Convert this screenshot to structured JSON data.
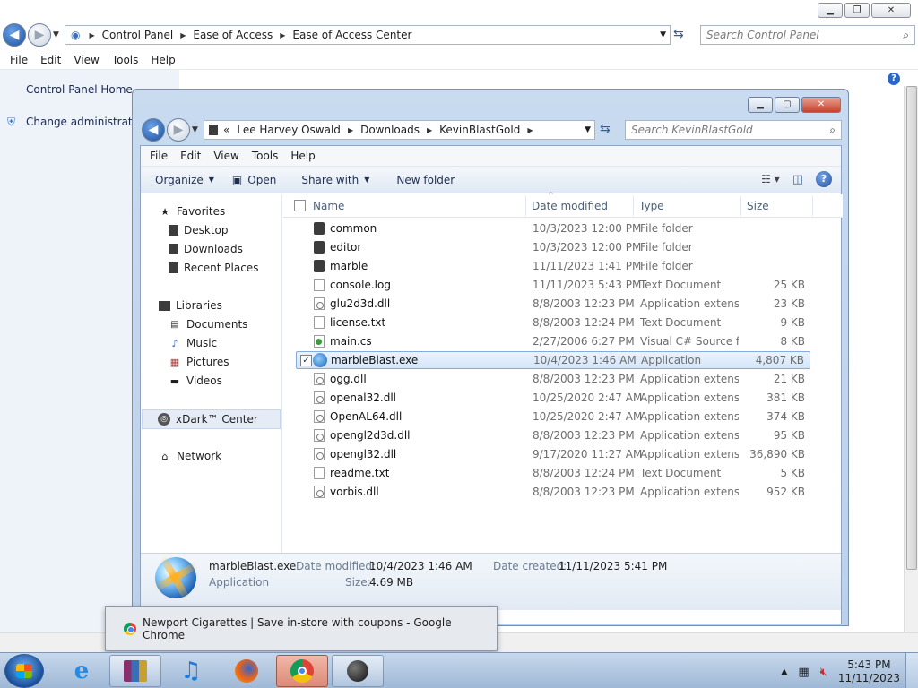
{
  "control_panel": {
    "breadcrumb": [
      "Control Panel",
      "Ease of Access",
      "Ease of Access Center"
    ],
    "search_placeholder": "Search Control Panel",
    "menu": [
      "File",
      "Edit",
      "View",
      "Tools",
      "Help"
    ],
    "sidebar_links": [
      "Control Panel Home",
      "Change administrative"
    ]
  },
  "explorer": {
    "breadcrumb": [
      "Lee Harvey Oswald",
      "Downloads",
      "KevinBlastGold"
    ],
    "overflow_marker": "«",
    "search_placeholder": "Search KevinBlastGold",
    "menu": [
      "File",
      "Edit",
      "View",
      "Tools",
      "Help"
    ],
    "toolbar": {
      "organize": "Organize",
      "open": "Open",
      "share_with": "Share with",
      "new_folder": "New folder"
    },
    "nav": {
      "favorites": "Favorites",
      "favorites_items": [
        "Desktop",
        "Downloads",
        "Recent Places"
      ],
      "libraries": "Libraries",
      "libraries_items": [
        "Documents",
        "Music",
        "Pictures",
        "Videos"
      ],
      "xdark": "xDark™ Center",
      "network": "Network"
    },
    "columns": {
      "name": "Name",
      "date": "Date modified",
      "type": "Type",
      "size": "Size"
    },
    "files": [
      {
        "name": "common",
        "date": "10/3/2023 12:00 PM",
        "type": "File folder",
        "size": "",
        "icon": "folder-icon"
      },
      {
        "name": "editor",
        "date": "10/3/2023 12:00 PM",
        "type": "File folder",
        "size": "",
        "icon": "folder-icon"
      },
      {
        "name": "marble",
        "date": "11/11/2023 1:41 PM",
        "type": "File folder",
        "size": "",
        "icon": "folder-icon"
      },
      {
        "name": "console.log",
        "date": "11/11/2023 5:43 PM",
        "type": "Text Document",
        "size": "25 KB",
        "icon": "document-icon"
      },
      {
        "name": "glu2d3d.dll",
        "date": "8/8/2003 12:23 PM",
        "type": "Application extens...",
        "size": "23 KB",
        "icon": "dll-icon"
      },
      {
        "name": "license.txt",
        "date": "8/8/2003 12:24 PM",
        "type": "Text Document",
        "size": "9 KB",
        "icon": "document-icon"
      },
      {
        "name": "main.cs",
        "date": "2/27/2006 6:27 PM",
        "type": "Visual C# Source f...",
        "size": "8 KB",
        "icon": "csharp-icon"
      },
      {
        "name": "marbleBlast.exe",
        "date": "10/4/2023 1:46 AM",
        "type": "Application",
        "size": "4,807 KB",
        "icon": "exe-icon"
      },
      {
        "name": "ogg.dll",
        "date": "8/8/2003 12:23 PM",
        "type": "Application extens...",
        "size": "21 KB",
        "icon": "dll-icon"
      },
      {
        "name": "openal32.dll",
        "date": "10/25/2020 2:47 AM",
        "type": "Application extens...",
        "size": "381 KB",
        "icon": "dll-icon"
      },
      {
        "name": "OpenAL64.dll",
        "date": "10/25/2020 2:47 AM",
        "type": "Application extens...",
        "size": "374 KB",
        "icon": "dll-icon"
      },
      {
        "name": "opengl2d3d.dll",
        "date": "8/8/2003 12:23 PM",
        "type": "Application extens...",
        "size": "95 KB",
        "icon": "dll-icon"
      },
      {
        "name": "opengl32.dll",
        "date": "9/17/2020 11:27 AM",
        "type": "Application extens...",
        "size": "36,890 KB",
        "icon": "dll-icon"
      },
      {
        "name": "readme.txt",
        "date": "8/8/2003 12:24 PM",
        "type": "Text Document",
        "size": "5 KB",
        "icon": "document-icon"
      },
      {
        "name": "vorbis.dll",
        "date": "8/8/2003 12:23 PM",
        "type": "Application extens...",
        "size": "952 KB",
        "icon": "dll-icon"
      }
    ],
    "selected_file": "marbleBlast.exe",
    "details": {
      "name": "marbleBlast.exe",
      "type": "Application",
      "date_modified_label": "Date modified:",
      "date_modified": "10/4/2023 1:46 AM",
      "date_created_label": "Date created:",
      "date_created": "11/11/2023 5:41 PM",
      "size_label": "Size:",
      "size": "4.69 MB"
    }
  },
  "chrome_tooltip": {
    "text": "Newport Cigarettes | Save in-store with coupons - Google Chrome"
  },
  "taskbar": {
    "apps": [
      "start-orb",
      "internet-explorer-icon",
      "winrar-icon",
      "itunes-icon",
      "firefox-icon",
      "chrome-icon",
      "marbleblast-icon"
    ],
    "clock_time": "5:43 PM",
    "clock_date": "11/11/2023"
  }
}
